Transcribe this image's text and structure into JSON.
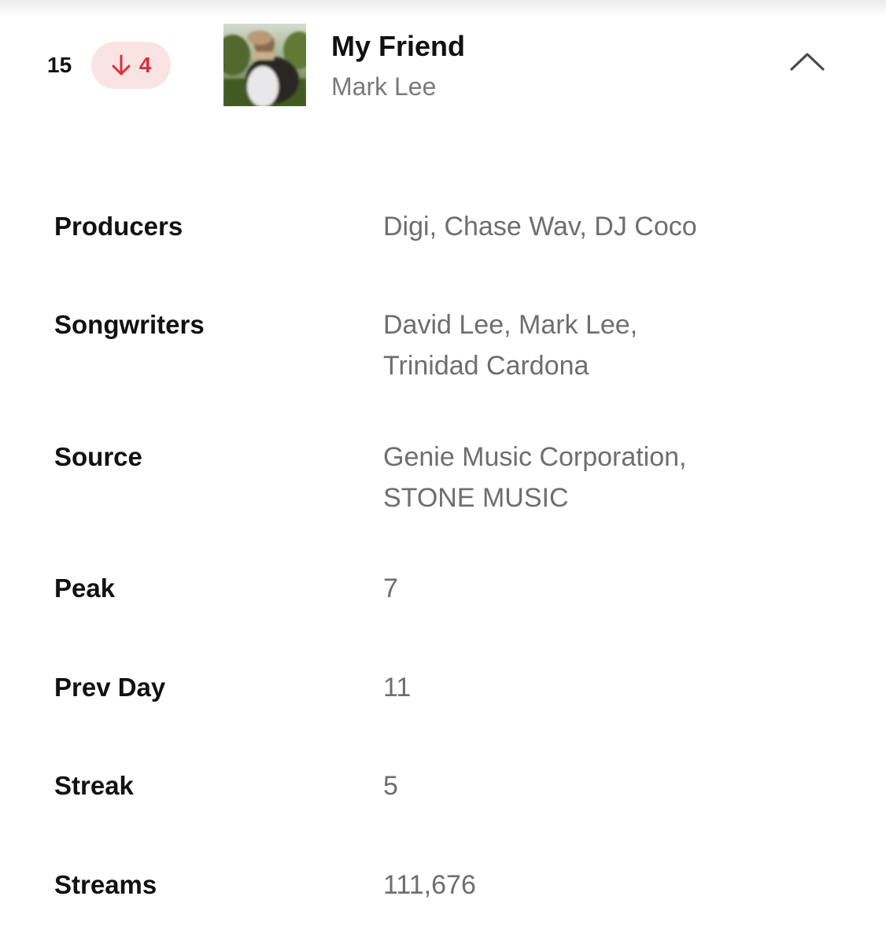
{
  "track": {
    "rank": "15",
    "change_value": "4",
    "change_direction": "down",
    "title": "My Friend",
    "artist": "Mark Lee"
  },
  "details": {
    "producers": {
      "label": "Producers",
      "value": "Digi, Chase Wav, DJ Coco"
    },
    "songwriters": {
      "label": "Songwriters",
      "line1": "David Lee, Mark Lee,",
      "line2": "Trinidad Cardona"
    },
    "source": {
      "label": "Source",
      "line1": "Genie Music Corporation,",
      "line2": "STONE MUSIC"
    },
    "peak": {
      "label": "Peak",
      "value": "7"
    },
    "prev_day": {
      "label": "Prev Day",
      "value": "11"
    },
    "streak": {
      "label": "Streak",
      "value": "5"
    },
    "streams": {
      "label": "Streams",
      "value": "111,676"
    }
  },
  "icons": {
    "change": "arrow-down-icon",
    "collapse": "chevron-up-icon"
  },
  "colors": {
    "accent_red": "#d9303b",
    "badge_bg": "#f9e3e3",
    "label_text": "#111111",
    "value_text": "#6e6e6e"
  }
}
